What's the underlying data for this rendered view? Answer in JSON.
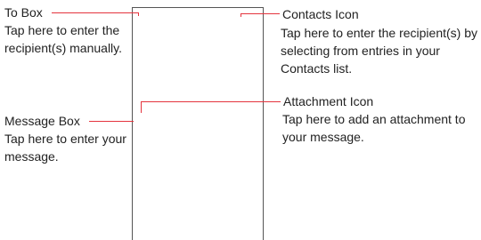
{
  "callouts": {
    "to_box": {
      "title": "To Box",
      "desc_line1": "Tap here to enter the",
      "desc_line2": "recipient(s) manually."
    },
    "contacts_icon": {
      "title": "Contacts Icon",
      "desc_line1": "Tap here to enter the recipient(s) by",
      "desc_line2": "selecting from entries in your",
      "desc_line3": "Contacts list."
    },
    "attachment_icon": {
      "title": "Attachment Icon",
      "desc_line1": "Tap here to add an attachment to",
      "desc_line2": "your message."
    },
    "message_box": {
      "title": "Message Box",
      "desc_line1": "Tap here to enter your",
      "desc_line2": "message."
    }
  },
  "colors": {
    "leader_line": "#e4343e",
    "phone_outline": "#555555",
    "text": "#222222"
  }
}
